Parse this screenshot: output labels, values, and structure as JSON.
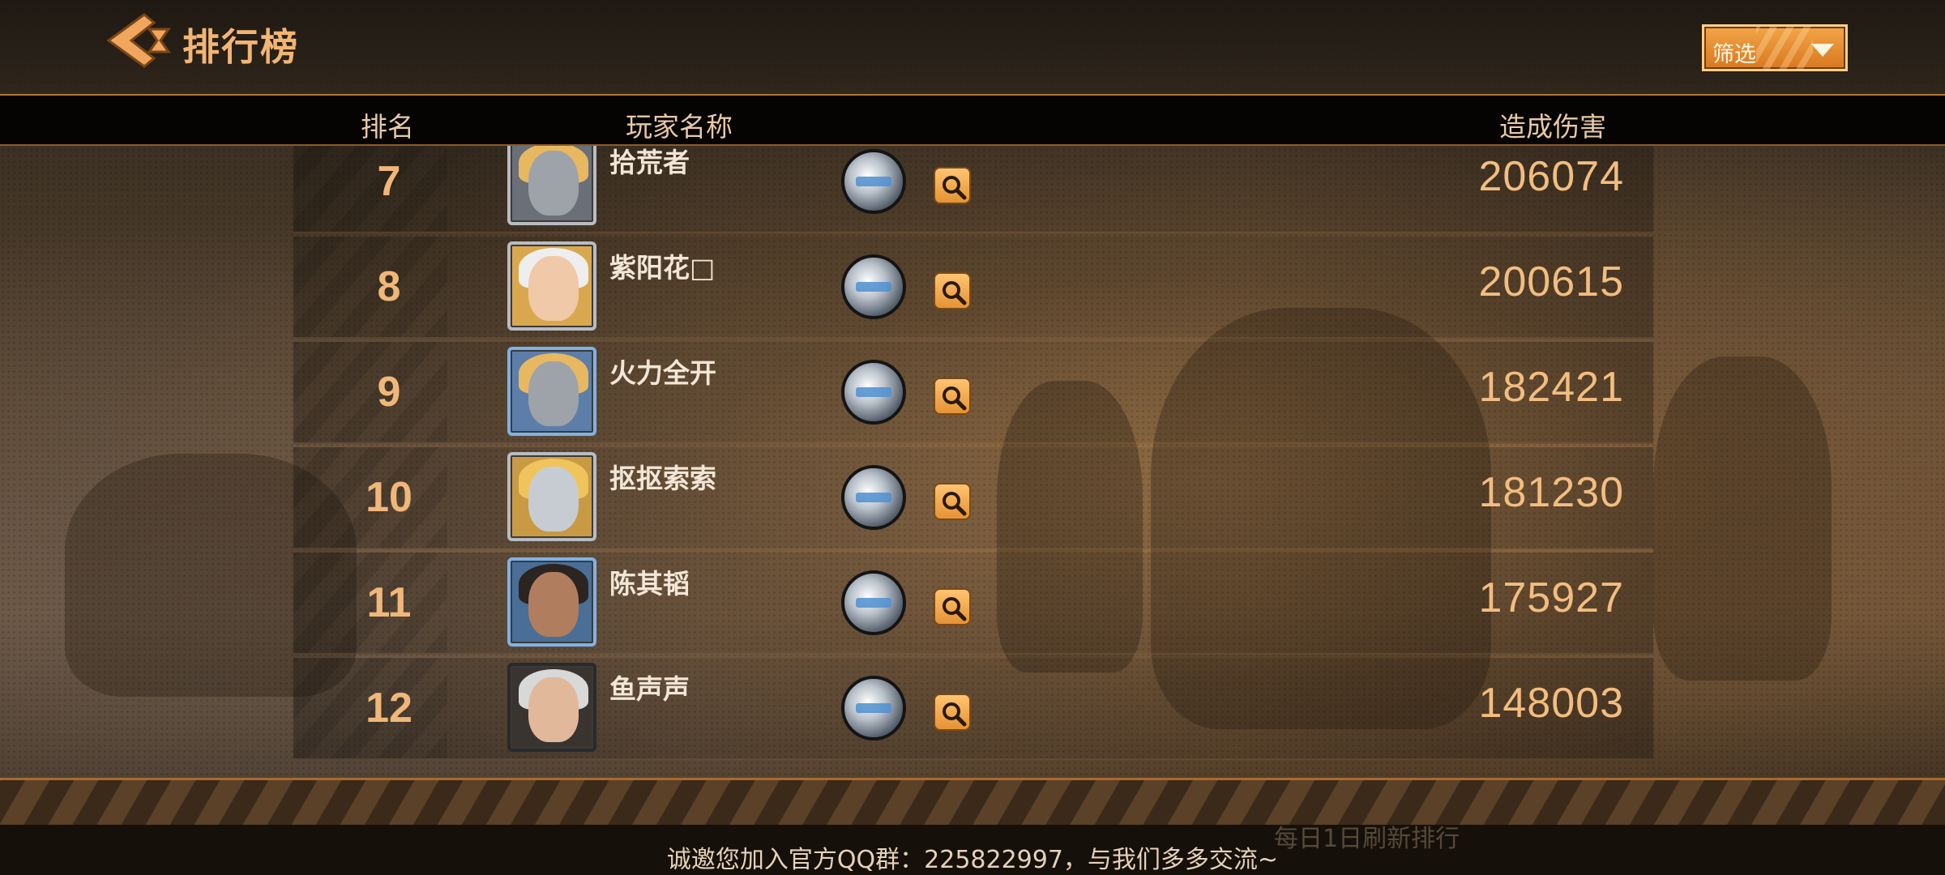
{
  "header": {
    "title": "排行榜",
    "filter_label": "筛选"
  },
  "columns": {
    "rank": "排名",
    "player_name": "玩家名称",
    "damage": "造成伤害"
  },
  "rows": [
    {
      "rank": "7",
      "name": "拾荒者",
      "damage": "206074",
      "avatar": "armored-blond-hero"
    },
    {
      "rank": "8",
      "name": "紫阳花□",
      "damage": "200615",
      "avatar": "white-haired-woman"
    },
    {
      "rank": "9",
      "name": "火力全开",
      "damage": "182421",
      "avatar": "armored-blond-hero"
    },
    {
      "rank": "10",
      "name": "抠抠索索",
      "damage": "181230",
      "avatar": "masked-blonde-woman"
    },
    {
      "rank": "11",
      "name": "陈其韬",
      "damage": "175927",
      "avatar": "dark-haired-man"
    },
    {
      "rank": "12",
      "name": "鱼声声",
      "damage": "148003",
      "avatar": "silver-haired-woman"
    }
  ],
  "footer": {
    "refresh_note": "每日1日刷新排行",
    "qq_note": "诚邀您加入官方QQ群：225822997，与我们多多交流~"
  },
  "colors": {
    "accent": "#f2b574",
    "rank_text": "#f0b77a",
    "damage_text": "#f2bd80",
    "filter_button": "#e58a2c"
  }
}
